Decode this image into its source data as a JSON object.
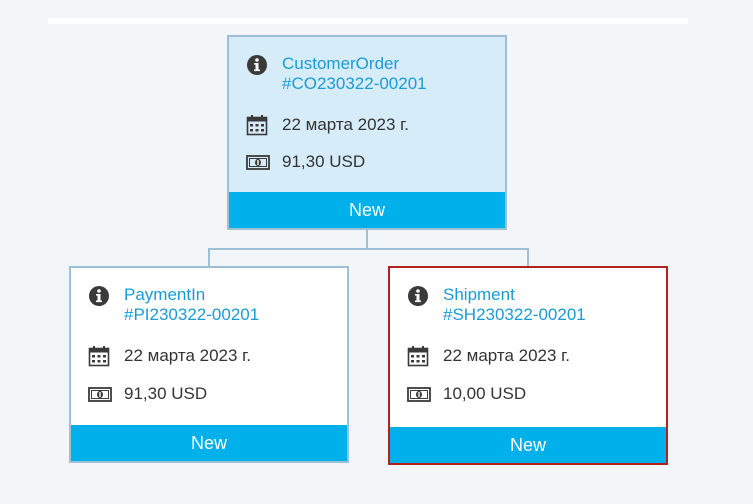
{
  "documents": {
    "customer_order": {
      "type": "CustomerOrder",
      "number": "#CO230322-00201",
      "date": "22 марта 2023 г.",
      "amount": "91,30 USD",
      "status": "New"
    },
    "payment_in": {
      "type": "PaymentIn",
      "number": "#PI230322-00201",
      "date": "22 марта 2023 г.",
      "amount": "91,30 USD",
      "status": "New"
    },
    "shipment": {
      "type": "Shipment",
      "number": "#SH230322-00201",
      "date": "22 марта 2023 г.",
      "amount": "10,00 USD",
      "status": "New"
    }
  },
  "icons": {
    "info": "info-icon",
    "calendar": "calendar-icon",
    "money": "money-icon"
  },
  "colors": {
    "link": "#1a9bd7",
    "status_bar": "#00b0ea",
    "root_card_bg": "#d6edf9",
    "card_border": "#9ec0d4",
    "selected_border": "#b3221f"
  }
}
